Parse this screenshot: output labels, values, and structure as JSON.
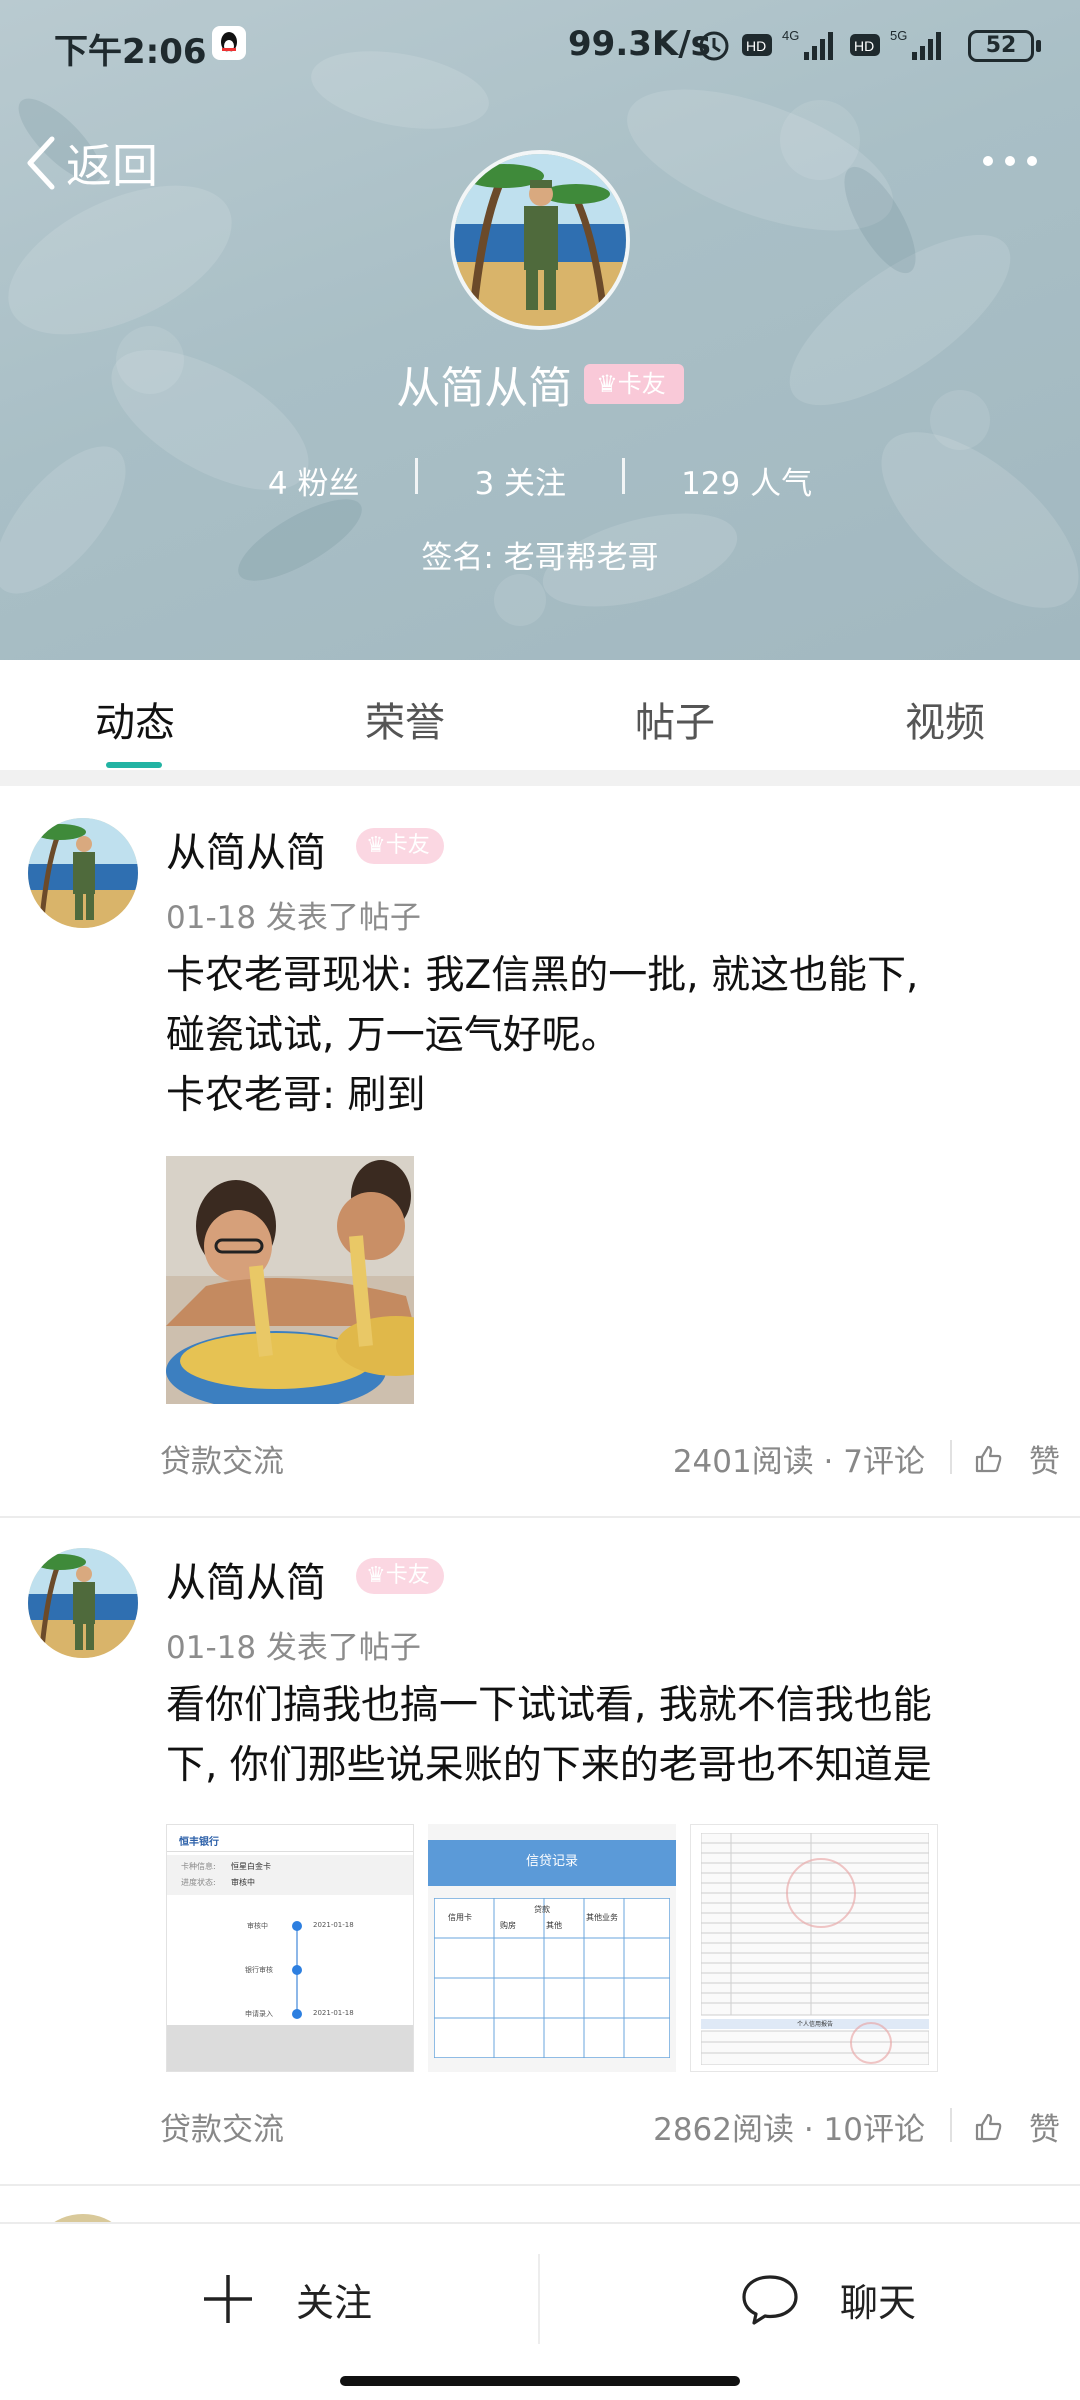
{
  "status_bar": {
    "time": "下午2:06",
    "network_speed": "99.3K/s",
    "battery": "52"
  },
  "nav": {
    "back_label": "返回"
  },
  "profile": {
    "name": "从简从简",
    "badge": "卡友",
    "stats": [
      {
        "label": "4 粉丝"
      },
      {
        "label": "3 关注"
      },
      {
        "label": "129 人气"
      }
    ],
    "signature": "签名: 老哥帮老哥"
  },
  "tabs": [
    {
      "label": "动态"
    },
    {
      "label": "荣誉"
    },
    {
      "label": "帖子"
    },
    {
      "label": "视频"
    }
  ],
  "posts": [
    {
      "author": "从简从简",
      "badge": "卡友",
      "meta": "01-18  发表了帖子",
      "lines": [
        "卡农老哥现状: 我Z信黑的一批, 就这也能下,",
        "碰瓷试试, 万一运气好呢。",
        "卡农老哥: 刷到"
      ],
      "category": "贷款交流",
      "counts": "2401阅读 · 7评论",
      "like_label": "赞"
    },
    {
      "author": "从简从简",
      "badge": "卡友",
      "meta": "01-18  发表了帖子",
      "lines": [
        "看你们搞我也搞一下试试看, 我就不信我也能",
        "下, 你们那些说呆账的下来的老哥也不知道是"
      ],
      "category": "贷款交流",
      "counts": "2862阅读 · 10评论",
      "like_label": "赞"
    }
  ],
  "thumb_texts": {
    "bank_name": "恒丰银行",
    "card_row_label": "卡种信息:",
    "card_row_value": "恒星白金卡",
    "status_row_label": "进度状态:",
    "status_row_value": "审核中",
    "steps": [
      "审核中",
      "银行审核",
      "申请录入"
    ],
    "dates": [
      "2021-01-18",
      "2021-01-18"
    ],
    "record_title": "信贷记录",
    "record_cols": [
      "信用卡",
      "贷款",
      "购房",
      "其他",
      "其他业务"
    ],
    "report_heading": "个人信用报告"
  },
  "bottom_bar": {
    "follow_label": "关注",
    "chat_label": "聊天"
  },
  "colors": {
    "accent": "#22b3a3",
    "badge_pink": "#f9c9d8",
    "header_bg": "#aabfc6"
  }
}
